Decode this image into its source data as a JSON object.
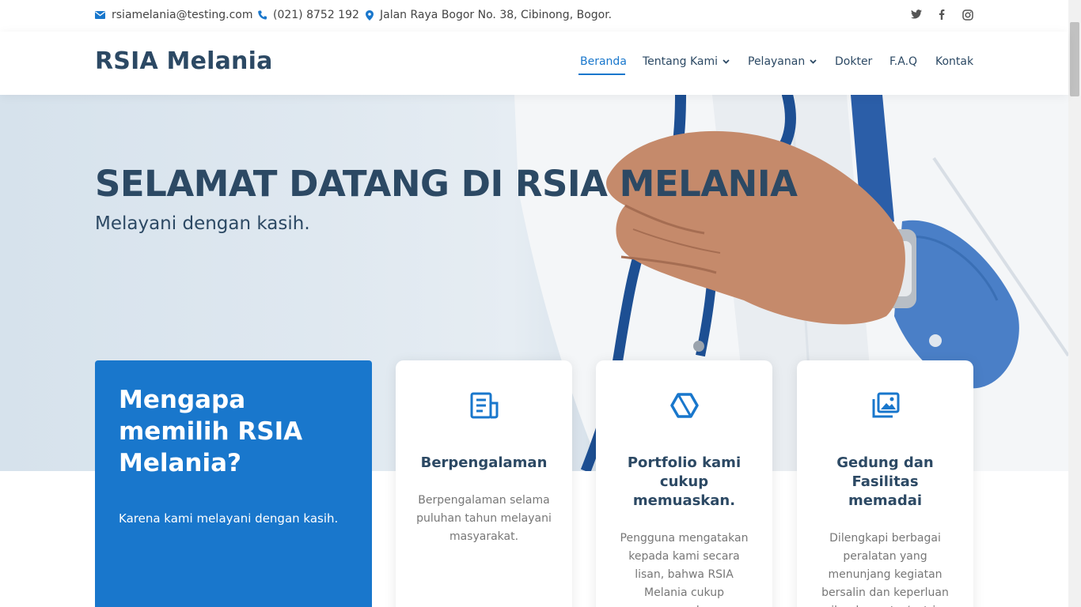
{
  "topbar": {
    "email": "rsiamelania@testing.com",
    "phone": "(021) 8752 192",
    "address": "Jalan Raya Bogor No. 38, Cibinong, Bogor.",
    "social": [
      "twitter-icon",
      "facebook-icon",
      "instagram-icon"
    ]
  },
  "header": {
    "logo": "RSIA Melania",
    "nav": [
      {
        "label": "Beranda",
        "active": true
      },
      {
        "label": "Tentang Kami",
        "dropdown": true
      },
      {
        "label": "Pelayanan",
        "dropdown": true
      },
      {
        "label": "Dokter"
      },
      {
        "label": "F.A.Q"
      },
      {
        "label": "Kontak"
      }
    ]
  },
  "hero": {
    "title": "SELAMAT DATANG DI RSIA MELANIA",
    "subtitle": "Melayani dengan kasih."
  },
  "why": {
    "title": "Mengapa memilih RSIA Melania?",
    "text": "Karena kami melayani dengan kasih."
  },
  "features": [
    {
      "icon": "receipt-icon",
      "title": "Berpengalaman",
      "text": "Berpengalaman selama puluhan tahun melayani masyarakat."
    },
    {
      "icon": "cube-icon",
      "title": "Portfolio kami cukup memuaskan.",
      "text": "Pengguna mengatakan kepada kami secara lisan, bahwa RSIA Melania cukup memuaskan."
    },
    {
      "icon": "images-icon",
      "title": "Gedung dan Fasilitas memadai",
      "text": "Dilengkapi berbagai peralatan yang menunjang kegiatan bersalin dan keperluan ibu dan putra/putri."
    }
  ],
  "colors": {
    "accent": "#1977cc",
    "heading": "#2c4964"
  }
}
